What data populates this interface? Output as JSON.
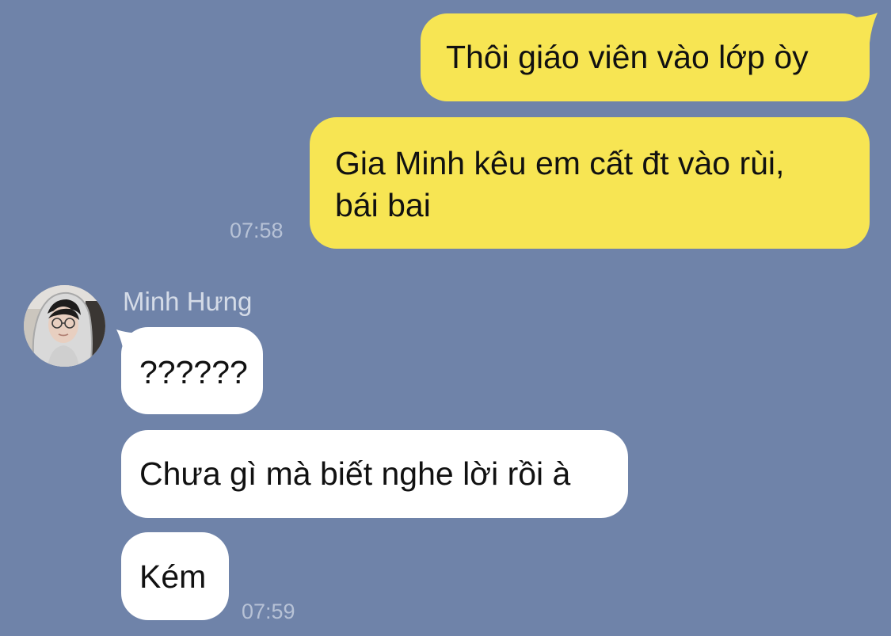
{
  "colors": {
    "background": "#6f83a9",
    "sent_bubble": "#f7e553",
    "received_bubble": "#ffffff",
    "timestamp": "#b7c2d6",
    "sender_name": "#d4dbe7"
  },
  "messages_sent": [
    {
      "text": "Thôi giáo viên vào lớp òy"
    },
    {
      "line1": "Gia Minh kêu em cất đt vào rùi,",
      "line2": "bái bai"
    }
  ],
  "sent_time": "07:58",
  "contact": {
    "name": "Minh Hưng",
    "avatar_icon": "profile-photo"
  },
  "messages_received": [
    {
      "text": "??????"
    },
    {
      "text": "Chưa gì mà biết nghe lời rồi à"
    },
    {
      "text": "Kém"
    }
  ],
  "received_time": "07:59"
}
